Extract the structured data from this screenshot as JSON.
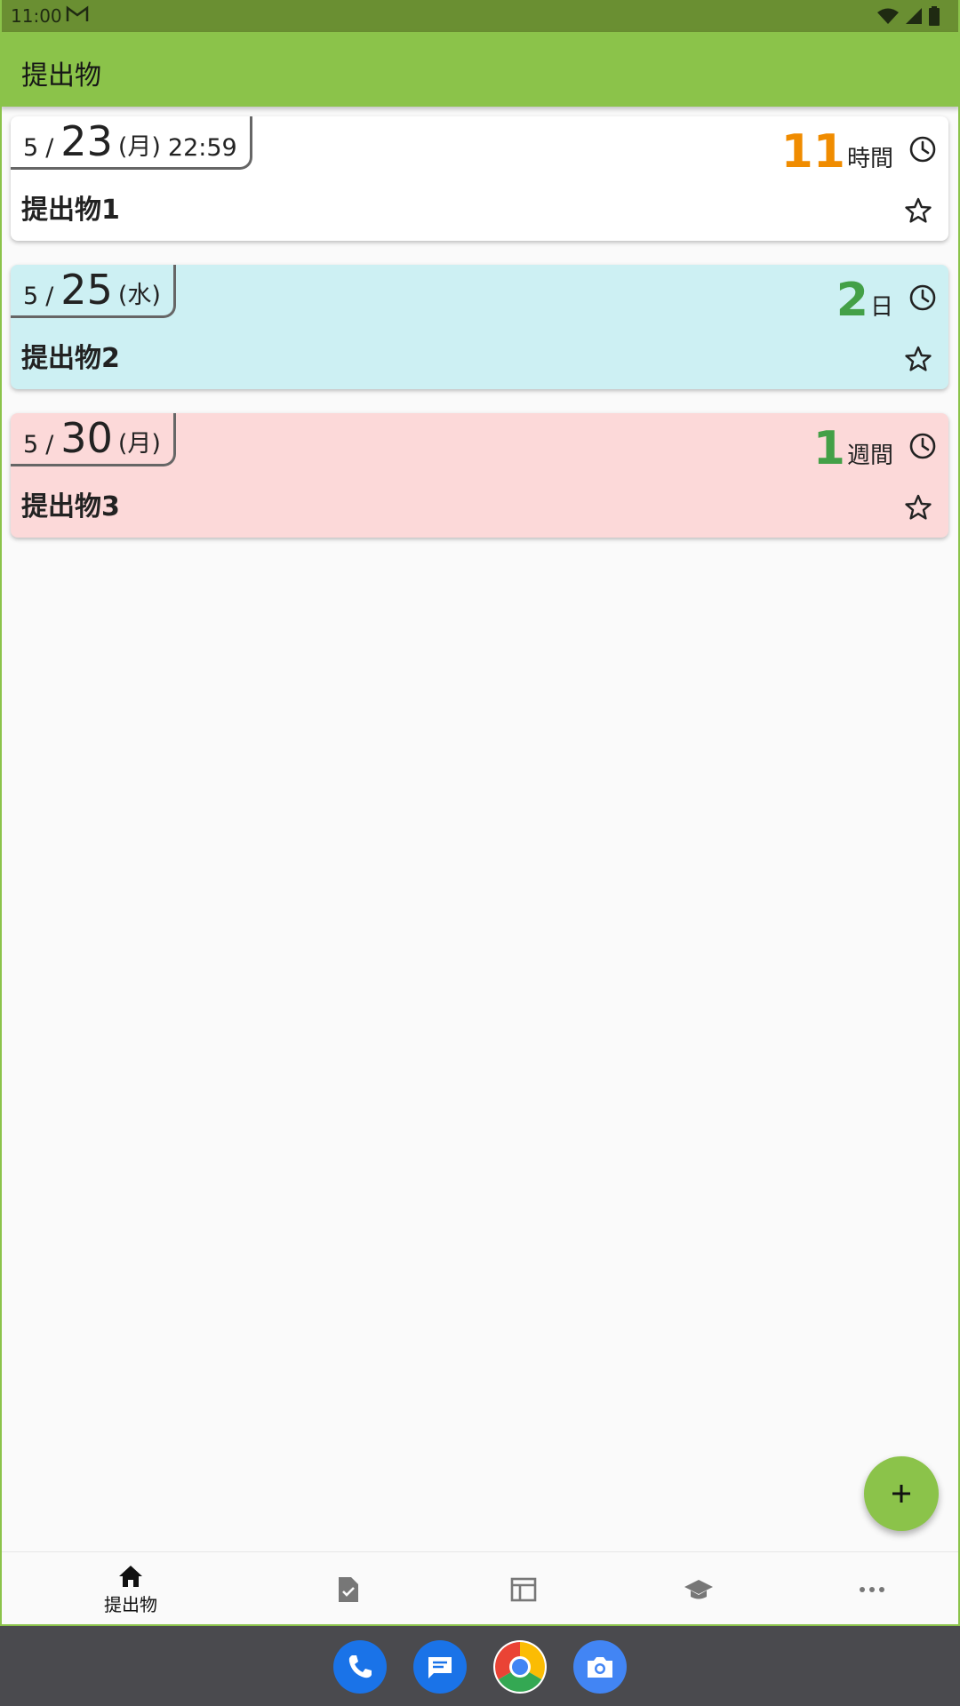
{
  "status_bar": {
    "time": "11:00",
    "mail_icon": "gmail-icon"
  },
  "app_bar": {
    "title": "提出物"
  },
  "cards": [
    {
      "month": "5",
      "slash": "/",
      "day": "23",
      "weekday": "(月)",
      "time": "22:59",
      "remaining_value": "11",
      "remaining_unit": "時間",
      "remaining_color": "#f08c00",
      "title": "提出物1",
      "bg": "#ffffff"
    },
    {
      "month": "5",
      "slash": "/",
      "day": "25",
      "weekday": "(水)",
      "time": "",
      "remaining_value": "2",
      "remaining_unit": "日",
      "remaining_color": "#43a047",
      "title": "提出物2",
      "bg": "#cdf0f3"
    },
    {
      "month": "5",
      "slash": "/",
      "day": "30",
      "weekday": "(月)",
      "time": "",
      "remaining_value": "1",
      "remaining_unit": "週間",
      "remaining_color": "#43a047",
      "title": "提出物3",
      "bg": "#fcd9d9"
    }
  ],
  "fab": {
    "icon": "plus-icon"
  },
  "bottom_nav": {
    "items": [
      {
        "icon": "home-icon",
        "label": "提出物"
      },
      {
        "icon": "assignment-check-icon",
        "label": ""
      },
      {
        "icon": "timetable-icon",
        "label": ""
      },
      {
        "icon": "school-icon",
        "label": ""
      },
      {
        "icon": "more-icon",
        "label": ""
      }
    ]
  },
  "dock": [
    "phone-icon",
    "messages-icon",
    "chrome-icon",
    "camera-icon"
  ],
  "colors": {
    "primary": "#8bc34a",
    "status_bar": "#6a8f32",
    "nav_bar": "#4a4a4e"
  }
}
